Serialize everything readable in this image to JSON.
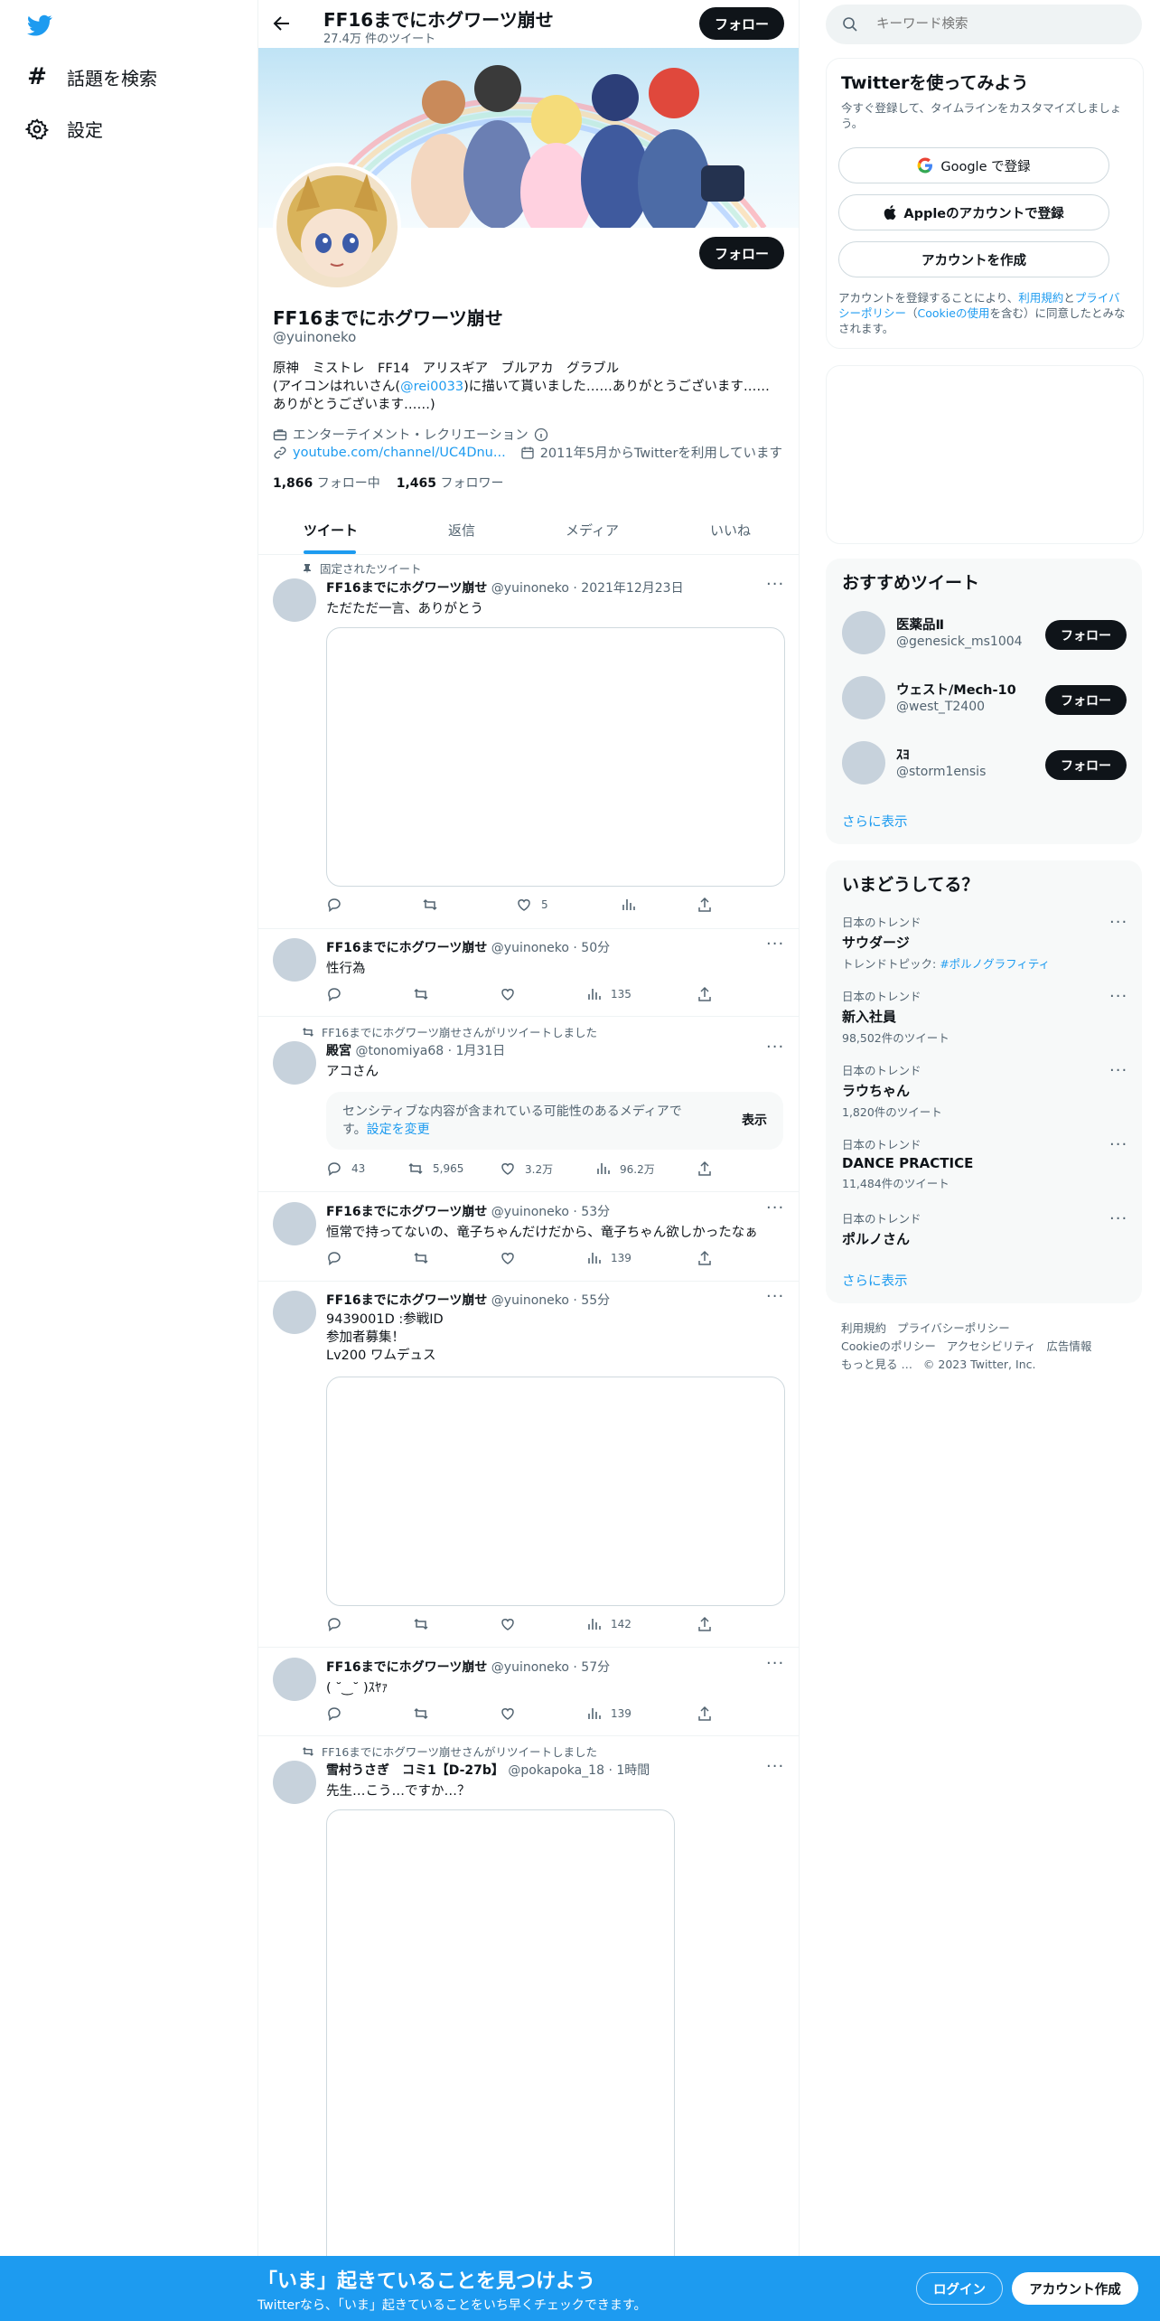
{
  "nav": {
    "explore_label": "話題を検索",
    "settings_label": "設定"
  },
  "header": {
    "title": "FF16までにホグワーツ崩せ",
    "tweet_count": "27.4万 件のツイート",
    "follow_label": "フォロー"
  },
  "profile": {
    "display_name": "FF16までにホグワーツ崩せ",
    "handle": "@yuinoneko",
    "follow_label": "フォロー",
    "bio_line1": "原神　ミストレ　FF14　アリスギア　ブルアカ　グラブル",
    "bio_line2_pre": "(アイコンはれいさん(",
    "bio_mention": "@rei0033",
    "bio_line2_post": ")に描いて貰いました……ありがとうございます……",
    "bio_line3": "ありがとうございます……)",
    "category": "エンターテイメント・レクリエーション",
    "link": "youtube.com/channel/UC4Dnu...",
    "joined": "2011年5月からTwitterを利用しています",
    "following_count": "1,866",
    "following_label": "フォロー中",
    "followers_count": "1,465",
    "followers_label": "フォロワー"
  },
  "tabs": [
    {
      "label": "ツイート"
    },
    {
      "label": "返信"
    },
    {
      "label": "メディア"
    },
    {
      "label": "いいね"
    }
  ],
  "tweets": [
    {
      "pinned_label": "固定されたツイート",
      "name": "FF16までにホグワーツ崩せ",
      "handle": "@yuinoneko",
      "time": "· 2021年12月23日",
      "text": "ただただ一言、ありがとう",
      "likes": "5"
    },
    {
      "name": "FF16までにホグワーツ崩せ",
      "handle": "@yuinoneko",
      "time": "· 50分",
      "text": "性行為",
      "views": "135"
    },
    {
      "retweet_label": "FF16までにホグワーツ崩せさんがリツイートしました",
      "name": "殿宮",
      "handle": "@tonomiya68",
      "time": "· 1月31日",
      "text": "アコさん",
      "sensitive_text1": "センシティブな内容が含まれている可能性のあるメディアで",
      "sensitive_text2_pre": "す。",
      "sensitive_link": "設定を変更",
      "show_label": "表示",
      "replies": "43",
      "retweets": "5,965",
      "likes": "3.2万",
      "views": "96.2万"
    },
    {
      "name": "FF16までにホグワーツ崩せ",
      "handle": "@yuinoneko",
      "time": "· 53分",
      "text": "恒常で持ってないの、竜子ちゃんだけだから、竜子ちゃん欲しかったなぁ",
      "views": "139"
    },
    {
      "name": "FF16までにホグワーツ崩せ",
      "handle": "@yuinoneko",
      "time": "· 55分",
      "text1": "9439001D :参戦ID",
      "text2": "参加者募集！",
      "text3": "Lv200 ワムデュス",
      "views": "142"
    },
    {
      "name": "FF16までにホグワーツ崩せ",
      "handle": "@yuinoneko",
      "time": "· 57分",
      "text": "( ˘‿˘ )ｽﾔｧ",
      "views": "139"
    },
    {
      "retweet_label": "FF16までにホグワーツ崩せさんがリツイートしました",
      "name": "雪村うさぎ　コミ1【D-27b】",
      "handle": "@pokapoka_18",
      "time": "· 1時間",
      "text": "先生…こう…ですか…？"
    }
  ],
  "search": {
    "placeholder": "キーワード検索"
  },
  "signup": {
    "title": "Twitterを使ってみよう",
    "subtitle": "今すぐ登録して、タイムラインをカスタマイズしましょう。",
    "google_label": "Google で登録",
    "apple_label": "Appleのアカウントで登録",
    "create_label": "アカウントを作成",
    "legal_pre": "アカウントを登録することにより、",
    "legal_terms": "利用規約",
    "legal_and": "と",
    "legal_privacy": "プライバシーポリシー",
    "legal_paren_open": "（",
    "legal_cookie": "Cookieの使用",
    "legal_post": "を含む）に同意したとみなされます。"
  },
  "recommended": {
    "title": "おすすめツイート",
    "users": [
      {
        "name": "医薬品Ⅱ",
        "handle": "@genesick_ms1004",
        "follow_label": "フォロー"
      },
      {
        "name": "ウェスト/Mech-10",
        "handle": "@west_T2400",
        "follow_label": "フォロー"
      },
      {
        "name": "ｽﾖ",
        "handle": "@storm1ensis",
        "follow_label": "フォロー"
      }
    ],
    "show_more": "さらに表示"
  },
  "trends": {
    "title": "いまどうしてる？",
    "items": [
      {
        "context": "日本のトレンド",
        "name": "サウダージ",
        "extra_pre": "トレンドトピック: ",
        "extra_link": "#ポルノグラフィティ"
      },
      {
        "context": "日本のトレンド",
        "name": "新入社員",
        "extra": "98,502件のツイート"
      },
      {
        "context": "日本のトレンド",
        "name": "ラウちゃん",
        "extra": "1,820件のツイート"
      },
      {
        "context": "日本のトレンド",
        "name": "DANCE PRACTICE",
        "extra": "11,484件のツイート"
      },
      {
        "context": "日本のトレンド",
        "name": "ポルノさん",
        "extra": ""
      }
    ],
    "show_more": "さらに表示"
  },
  "footer": {
    "terms": "利用規約",
    "privacy": "プライバシーポリシー",
    "cookie": "Cookieのポリシー",
    "accessibility": "アクセシビリティ",
    "ads": "広告情報",
    "more": "もっと見る …",
    "copyright": "© 2023 Twitter, Inc."
  },
  "bottom_bar": {
    "title": "「いま」起きていることを見つけよう",
    "subtitle": "Twitterなら、「いま」起きていることをいち早くチェックできます。",
    "login_label": "ログイン",
    "signup_label": "アカウント作成"
  },
  "colors": {
    "accent": "#1d9bf0",
    "dark": "#0f1419",
    "gray": "#536471",
    "panel": "#f7f9f9"
  }
}
